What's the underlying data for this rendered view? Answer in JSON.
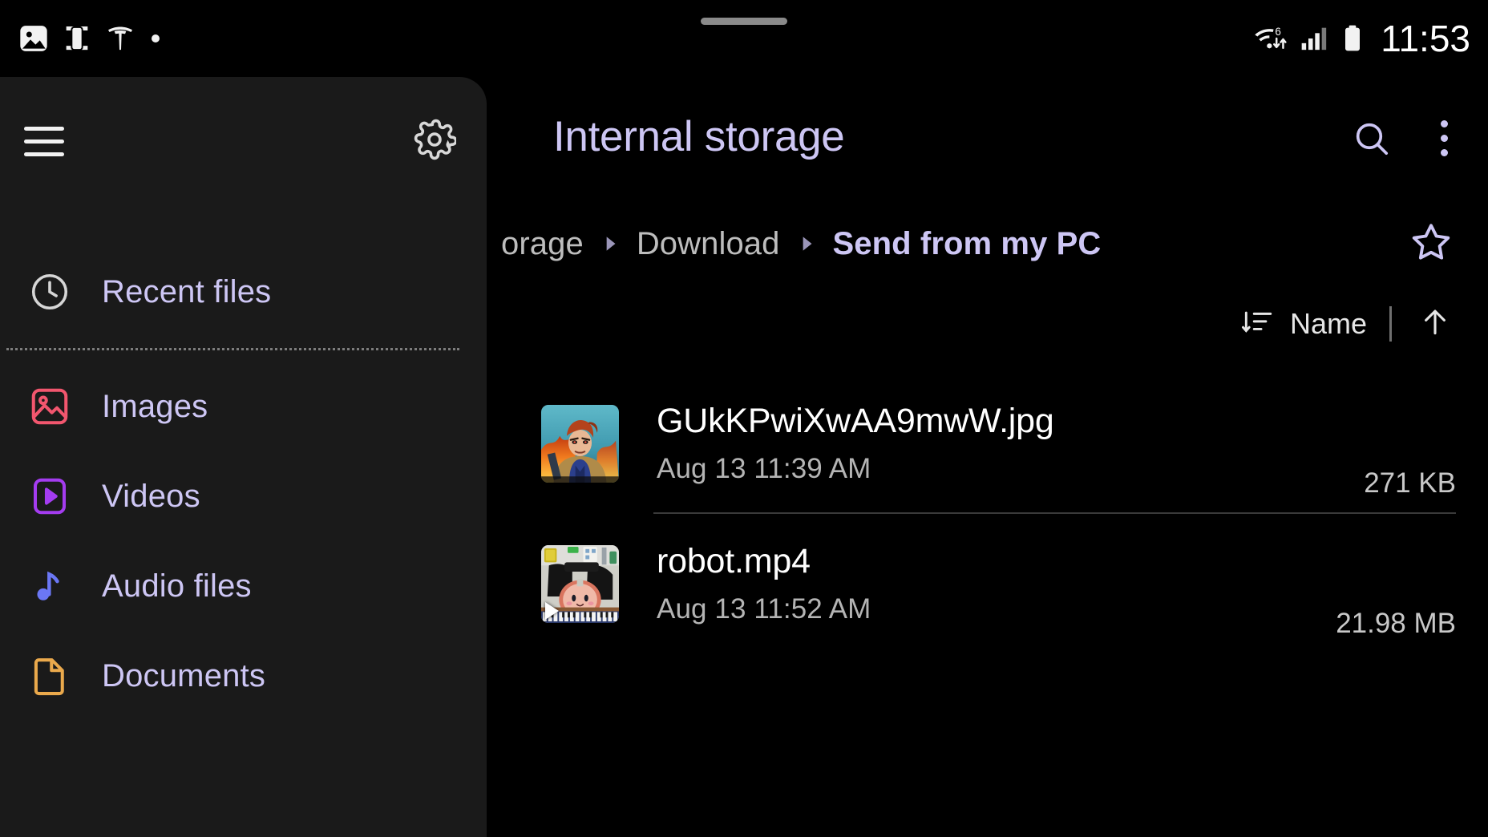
{
  "status_bar": {
    "time": "11:53",
    "left_icons": [
      "photo-icon",
      "screen-cast-icon",
      "tesla-icon",
      "dot-indicator-icon"
    ],
    "right_icons": [
      "wifi-6-icon",
      "cellular-signal-icon",
      "battery-full-icon"
    ]
  },
  "sidebar": {
    "menu_icon": "hamburger-menu-icon",
    "settings_icon": "gear-icon",
    "items": [
      {
        "label": "Recent files",
        "icon": "clock-icon",
        "color": "#d6d6d6"
      },
      {
        "label": "Images",
        "icon": "image-icon",
        "color": "#f2566e"
      },
      {
        "label": "Videos",
        "icon": "video-play-icon",
        "color": "#a43cf0"
      },
      {
        "label": "Audio files",
        "icon": "music-note-icon",
        "color": "#6b77f5"
      },
      {
        "label": "Documents",
        "icon": "document-icon",
        "color": "#eaa94c"
      }
    ]
  },
  "main": {
    "title": "Internal storage",
    "search_icon": "search-icon",
    "overflow_icon": "more-vertical-icon",
    "favorite_icon": "star-outline-icon",
    "breadcrumb": [
      {
        "label": "orage",
        "current": false
      },
      {
        "label": "Download",
        "current": false
      },
      {
        "label": "Send from my PC",
        "current": true
      }
    ],
    "sort": {
      "icon": "sort-descending-icon",
      "field": "Name",
      "direction_icon": "arrow-up-icon"
    },
    "files": [
      {
        "name": "GUkKPwiXwAA9mwW.jpg",
        "date": "Aug 13 11:39 AM",
        "size": "271 KB",
        "type": "image",
        "thumbnail": "comic-character-thumbnail"
      },
      {
        "name": "robot.mp4",
        "date": "Aug 13 11:52 AM",
        "size": "21.98 MB",
        "type": "video",
        "thumbnail": "drum-kit-thumbnail"
      }
    ]
  },
  "colors": {
    "accent_lavender": "#cdc6f4",
    "sidebar_bg": "#1a1a1a",
    "main_bg": "#000000",
    "text_primary": "#ffffff",
    "text_secondary": "#b4b4b4"
  }
}
